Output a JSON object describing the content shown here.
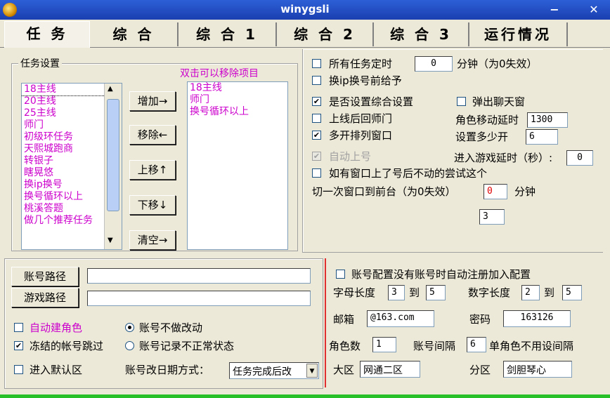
{
  "window": {
    "title": "winygsli",
    "minimize": "−",
    "close": "✕"
  },
  "tabs": [
    "任 务",
    "综 合",
    "综 合 1",
    "综 合 2",
    "综 合 3",
    "运行情况"
  ],
  "task_settings": {
    "legend": "任务设置",
    "removable_hint": "双击可以移除项目",
    "available_tasks": [
      "18主线",
      "20主线",
      "25主线",
      "师门",
      "初级环任务",
      "天熙城跑商",
      "转银子",
      "瞎晃悠",
      "换ip换号",
      "换号循环以上",
      "桃溪答题",
      "做几个推荐任务"
    ],
    "selected_tasks": [
      "18主线",
      "师门",
      "换号循环以上"
    ],
    "buttons": {
      "add": "增加→",
      "remove": "移除←",
      "up": "上移↑",
      "down": "下移↓",
      "clear": "清空→"
    }
  },
  "options": {
    "all_timer_label": "所有任务定时",
    "all_timer_value": "0",
    "all_timer_unit": "分钟（为0失效）",
    "ip_before": "换ip换号前给予",
    "comprehensive": "是否设置综合设置",
    "comprehensive_checked": true,
    "chat_popup": "弹出聊天窗",
    "return_master": "上线后回师门",
    "move_delay_label": "角色移动延时",
    "move_delay_value": "1300",
    "multi_window": "多开排列窗口",
    "multi_window_checked": true,
    "how_many_label": "设置多少开",
    "how_many_value": "6",
    "auto_login": "自动上号",
    "enter_delay_label": "进入游戏延时（秒）:",
    "enter_delay_value": "0",
    "stuck_retry": "如有窗口上了号后不动的尝试这个",
    "switch_front_label": "切一次窗口到前台（为0失效）",
    "switch_front_value": "0",
    "switch_front_unit": "分钟",
    "extra_value": "3"
  },
  "account": {
    "path_button": "账号路径",
    "game_path_button": "游戏路径",
    "path_value": "",
    "game_path_value": "",
    "auto_create": "自动建角色",
    "frozen_skip": "冻结的帐号跳过",
    "frozen_checked": true,
    "enter_default": "进入默认区",
    "no_change": "账号不做改动",
    "record_abnormal": "账号记录不正常状态",
    "date_method_label": "账号改日期方式：",
    "date_method_value": "任务完成后改"
  },
  "register": {
    "auto_register": "账号配置没有账号时自动注册加入配置",
    "letter_len_label": "字母长度",
    "letter_from": "3",
    "to1": "到",
    "letter_to": "5",
    "digit_len_label": "数字长度",
    "digit_from": "2",
    "to2": "到",
    "digit_to": "5",
    "email_label": "邮箱",
    "email_value": "@163.com",
    "password_label": "密码",
    "password_value": "163126",
    "role_count_label": "角色数",
    "role_count_value": "1",
    "interval_label": "账号间隔",
    "interval_value": "6",
    "single_role_note": "单角色不用设间隔",
    "region_label": "大区",
    "region_value": "网通二区",
    "server_label": "分区",
    "server_value": "剑胆琴心"
  }
}
